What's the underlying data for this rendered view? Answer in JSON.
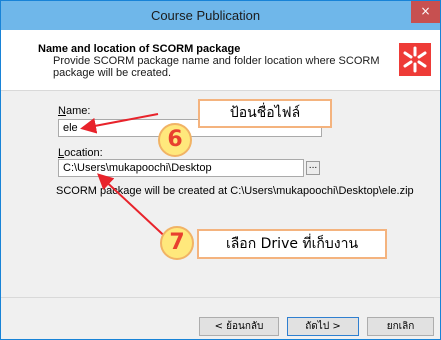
{
  "window": {
    "title": "Course Publication",
    "close_glyph": "×"
  },
  "header": {
    "title": "Name and location of SCORM package",
    "description": "Provide SCORM package name and folder location where SCORM package will be created.",
    "logo_icon": "ispring-logo-icon",
    "logo_color": "#ee3b37"
  },
  "form": {
    "name_label_acc": "N",
    "name_label_rest": "ame:",
    "name_value": "ele",
    "location_label_acc": "L",
    "location_label_rest": "ocation:",
    "location_value": "C:\\Users\\mukapoochi\\Desktop",
    "browse_label": "...",
    "info_text": "SCORM package will be created at C:\\Users\\mukapoochi\\Desktop\\ele.zip"
  },
  "buttons": {
    "back_label": "< ย้อนกลับ",
    "next_label": "ถัดไป >",
    "cancel_label": "ยกเลิก"
  },
  "annotations": {
    "step6_number": "6",
    "step6_text": "ป้อนชื่อไฟล์",
    "step7_number": "7",
    "step7_text": "เลือก Drive ที่เก็บงาน",
    "arrow_color": "#e8232b"
  }
}
